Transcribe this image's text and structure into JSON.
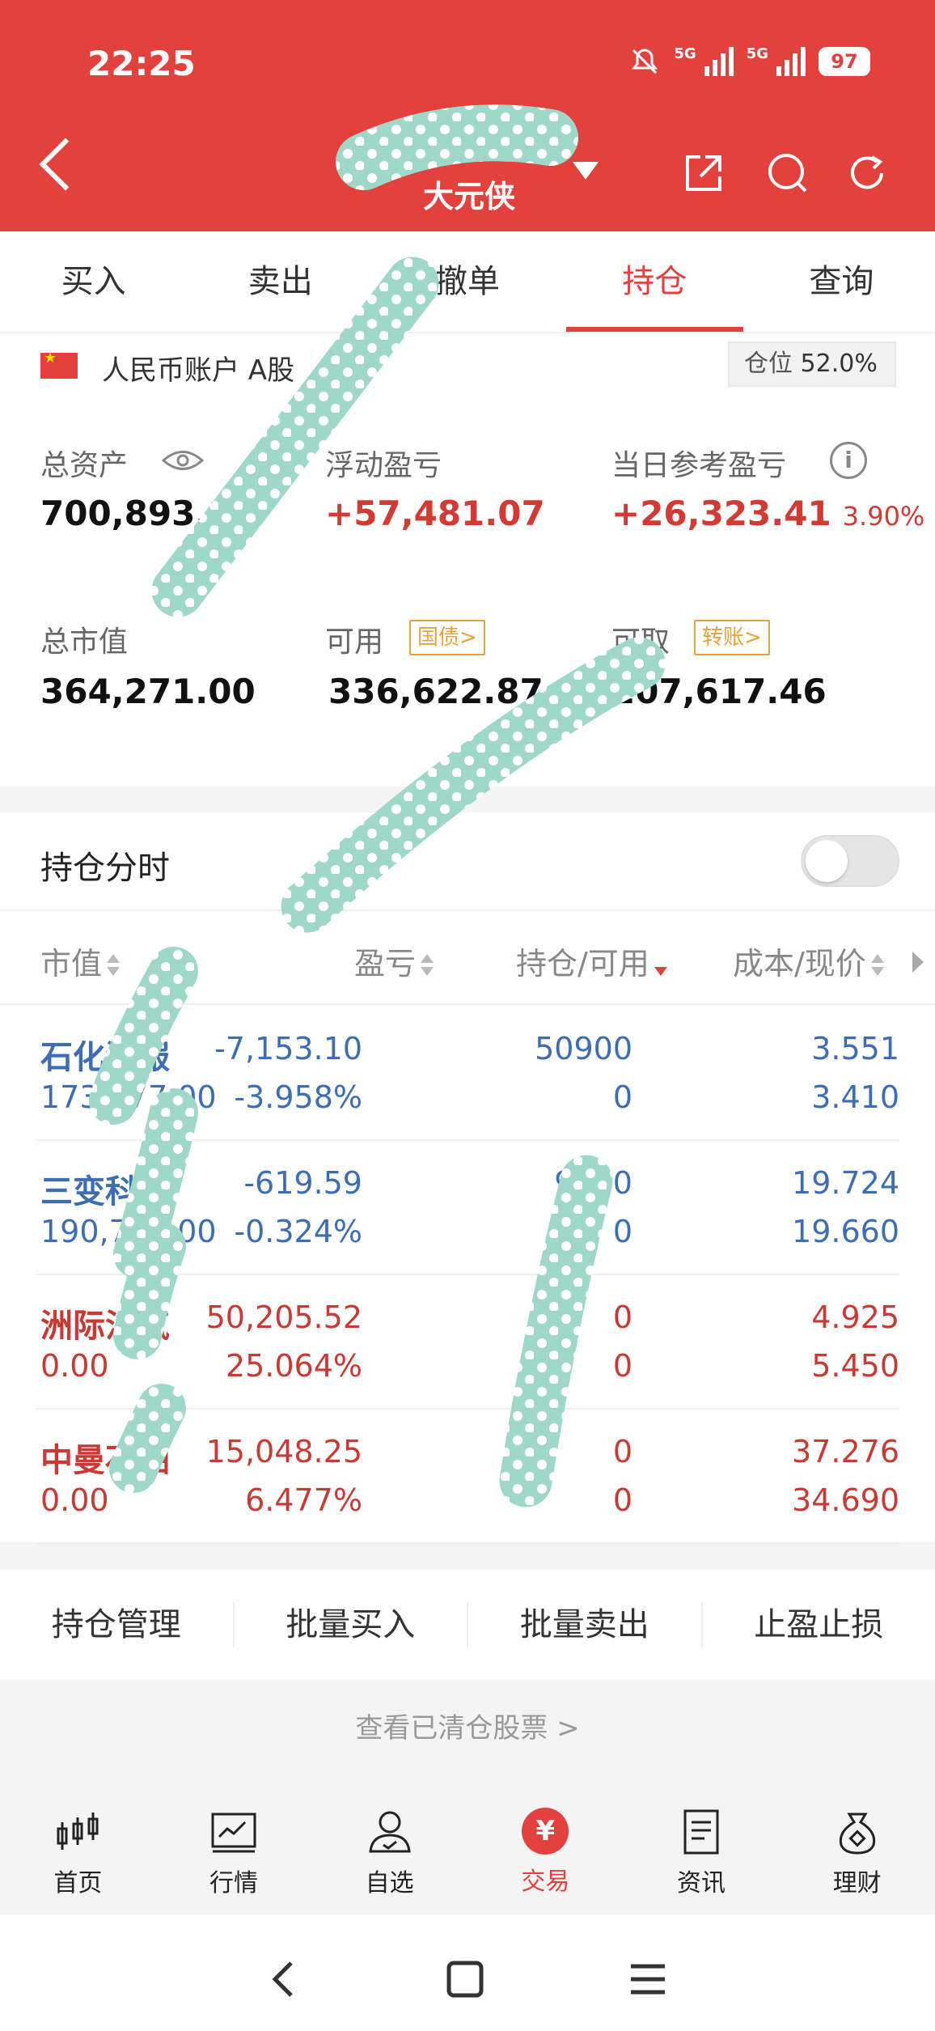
{
  "status_bar": {
    "time": "22:25",
    "network_1": "5G",
    "network_2": "5G",
    "battery": "97"
  },
  "header": {
    "broker_name": "",
    "account_name": "大元侠"
  },
  "tabs": [
    {
      "label": "买入"
    },
    {
      "label": "卖出"
    },
    {
      "label": "撤单"
    },
    {
      "label": "持仓",
      "active": true
    },
    {
      "label": "查询"
    }
  ],
  "account": {
    "label": "人民币账户 A股",
    "position_ratio_label": "仓位",
    "position_ratio_value": "52.0%",
    "total_assets_label": "总资产",
    "total_assets_value": "700,893.87",
    "floating_pnl_label": "浮动盈亏",
    "floating_pnl_value": "+57,481.07",
    "daily_pnl_label": "当日参考盈亏",
    "daily_pnl_value": "+26,323.41",
    "daily_pnl_pct": "3.90%",
    "market_value_label": "总市值",
    "market_value_value": "364,271.00",
    "available_label": "可用",
    "available_badge": "国债>",
    "available_value": "336,622.87",
    "withdrawable_label": "可取",
    "withdrawable_badge": "转账>",
    "withdrawable_value": "207,617.46"
  },
  "holding_section": {
    "title": "持仓分时",
    "toggle_on": false
  },
  "table": {
    "headers": {
      "market_value": "市值",
      "pnl": "盈亏",
      "qty": "持仓/可用",
      "cost": "成本/现价"
    },
    "rows": [
      {
        "name": "石化油服",
        "market_value": "173,577.00",
        "pnl": "-7,153.10",
        "pnl_pct": "-3.958%",
        "qty": "50900",
        "available": "0",
        "cost": "3.551",
        "price": "3.410",
        "color": "blue"
      },
      {
        "name": "三变科技",
        "market_value": "190,702.00",
        "pnl": "-619.59",
        "pnl_pct": "-0.324%",
        "qty": "9700",
        "available": "0",
        "cost": "19.724",
        "price": "19.660",
        "color": "blue"
      },
      {
        "name": "洲际油气",
        "market_value": "0.00",
        "pnl": "50,205.52",
        "pnl_pct": "25.064%",
        "qty": "0",
        "available": "0",
        "cost": "4.925",
        "price": "5.450",
        "color": "red"
      },
      {
        "name": "中曼石油",
        "market_value": "0.00",
        "pnl": "15,048.25",
        "pnl_pct": "6.477%",
        "qty": "0",
        "available": "0",
        "cost": "37.276",
        "price": "34.690",
        "color": "red"
      }
    ]
  },
  "actions": [
    {
      "label": "持仓管理"
    },
    {
      "label": "批量买入"
    },
    {
      "label": "批量卖出"
    },
    {
      "label": "止盈止损"
    }
  ],
  "cleared_link": "查看已清仓股票 >",
  "bottom_nav": [
    {
      "label": "首页",
      "icon": "candlestick-icon"
    },
    {
      "label": "行情",
      "icon": "chart-icon"
    },
    {
      "label": "自选",
      "icon": "user-check-icon"
    },
    {
      "label": "交易",
      "icon": "yuan-icon",
      "active": true
    },
    {
      "label": "资讯",
      "icon": "document-icon"
    },
    {
      "label": "理财",
      "icon": "moneybag-icon"
    }
  ],
  "colors": {
    "brand_red": "#e2413d",
    "loss_blue": "#3d6eb5",
    "gain_red": "#c83a33",
    "redaction": "#9fd8c9"
  }
}
